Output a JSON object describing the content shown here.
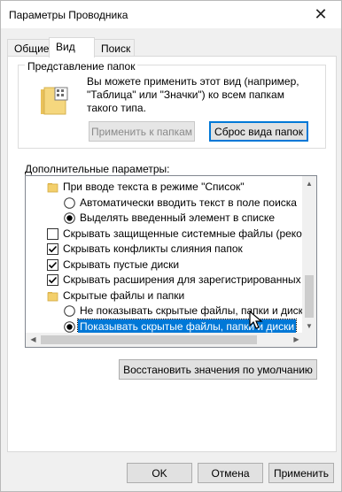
{
  "window": {
    "title": "Параметры Проводника",
    "close_glyph": "✕"
  },
  "tabs": [
    {
      "label": "Общие",
      "active": false
    },
    {
      "label": "Вид",
      "active": true
    },
    {
      "label": "Поиск",
      "active": false
    }
  ],
  "folder_view": {
    "legend": "Представление папок",
    "description": "Вы можете применить этот вид (например,\n\"Таблица\" или \"Значки\") ко всем папкам\nтакого типа.",
    "apply_button": "Применить к папкам",
    "reset_button": "Сброс вида папок"
  },
  "advanced": {
    "label": "Дополнительные параметры:",
    "rows": [
      {
        "type": "folder",
        "label": "При вводе текста в режиме \"Список\"",
        "indent": 0,
        "checked": false,
        "selected": false
      },
      {
        "type": "radio",
        "label": "Автоматически вводить текст в поле поиска",
        "indent": 1,
        "checked": false,
        "selected": false
      },
      {
        "type": "radio",
        "label": "Выделять введенный элемент в списке",
        "indent": 1,
        "checked": true,
        "selected": false
      },
      {
        "type": "checkbox",
        "label": "Скрывать защищенные системные файлы (рекомен",
        "indent": 0,
        "checked": false,
        "selected": false
      },
      {
        "type": "checkbox",
        "label": "Скрывать конфликты слияния папок",
        "indent": 0,
        "checked": true,
        "selected": false
      },
      {
        "type": "checkbox",
        "label": "Скрывать пустые диски",
        "indent": 0,
        "checked": true,
        "selected": false
      },
      {
        "type": "checkbox",
        "label": "Скрывать расширения для зарегистрированных типо",
        "indent": 0,
        "checked": true,
        "selected": false
      },
      {
        "type": "folder",
        "label": "Скрытые файлы и папки",
        "indent": 0,
        "checked": false,
        "selected": false
      },
      {
        "type": "radio",
        "label": "Не показывать скрытые файлы, папки и диски",
        "indent": 1,
        "checked": false,
        "selected": false
      },
      {
        "type": "radio",
        "label": "Показывать скрытые файлы, папки и диски",
        "indent": 1,
        "checked": true,
        "selected": true
      }
    ]
  },
  "restore_button": "Восстановить значения по умолчанию",
  "footer": {
    "ok": "OK",
    "cancel": "Отмена",
    "apply": "Применить"
  },
  "colors": {
    "accent": "#0078d7",
    "folder": "#f3cf6b",
    "window_bg": "#f0f0f0"
  },
  "icons": {
    "close": "close-icon",
    "folder": "folder-icon",
    "view": "folder-view-icon",
    "cursor": "mouse-pointer-icon"
  }
}
